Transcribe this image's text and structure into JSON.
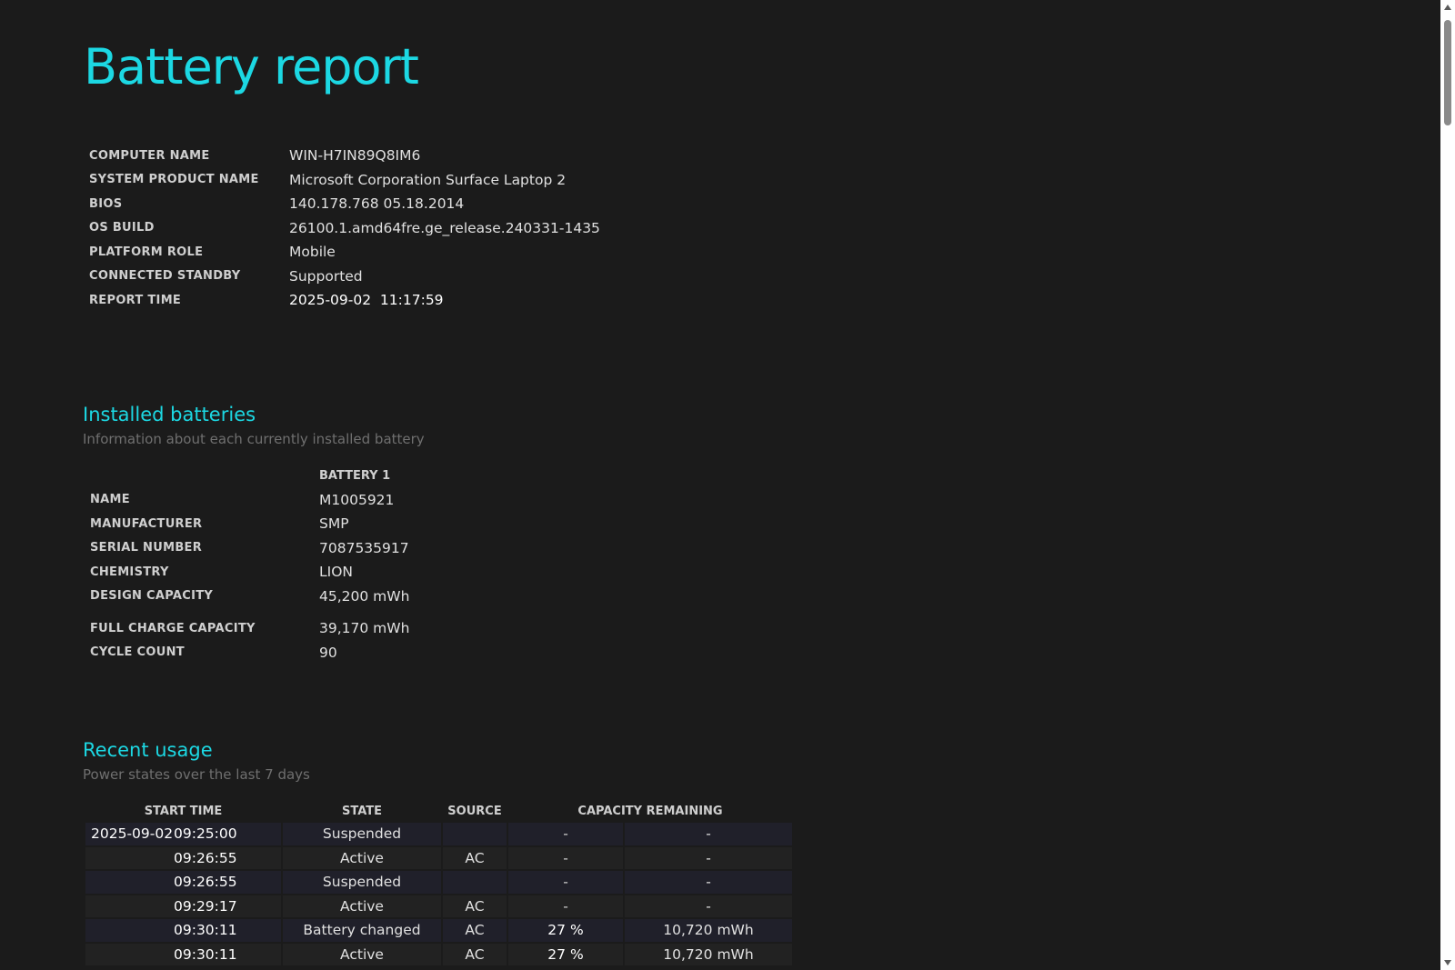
{
  "title": "Battery report",
  "system": [
    {
      "label": "COMPUTER NAME",
      "value": "WIN-H7IN89Q8IM6"
    },
    {
      "label": "SYSTEM PRODUCT NAME",
      "value": "Microsoft Corporation Surface Laptop 2"
    },
    {
      "label": "BIOS",
      "value": "140.178.768 05.18.2014"
    },
    {
      "label": "OS BUILD",
      "value": "26100.1.amd64fre.ge_release.240331-1435"
    },
    {
      "label": "PLATFORM ROLE",
      "value": "Mobile"
    },
    {
      "label": "CONNECTED STANDBY",
      "value": "Supported"
    },
    {
      "label": "REPORT TIME",
      "value": "2025-09-02  11:17:59"
    }
  ],
  "installed_batteries": {
    "heading": "Installed batteries",
    "subtitle": "Information about each currently installed battery",
    "column": "BATTERY 1",
    "rows": [
      {
        "label": "NAME",
        "value": "M1005921"
      },
      {
        "label": "MANUFACTURER",
        "value": "SMP"
      },
      {
        "label": "SERIAL NUMBER",
        "value": "7087535917"
      },
      {
        "label": "CHEMISTRY",
        "value": "LION"
      },
      {
        "label": "DESIGN CAPACITY",
        "value": "45,200 mWh"
      },
      {
        "label": "FULL CHARGE CAPACITY",
        "value": "39,170 mWh"
      },
      {
        "label": "CYCLE COUNT",
        "value": "90"
      }
    ]
  },
  "recent_usage": {
    "heading": "Recent usage",
    "subtitle": "Power states over the last 7 days",
    "columns": [
      "START TIME",
      "STATE",
      "SOURCE",
      "CAPACITY REMAINING"
    ],
    "rows": [
      {
        "date": "2025-09-02",
        "time": "09:25:00",
        "state": "Suspended",
        "source": "",
        "pct": "-",
        "mwh": "-"
      },
      {
        "date": "",
        "time": "09:26:55",
        "state": "Active",
        "source": "AC",
        "pct": "-",
        "mwh": "-"
      },
      {
        "date": "",
        "time": "09:26:55",
        "state": "Suspended",
        "source": "",
        "pct": "-",
        "mwh": "-"
      },
      {
        "date": "",
        "time": "09:29:17",
        "state": "Active",
        "source": "AC",
        "pct": "-",
        "mwh": "-"
      },
      {
        "date": "",
        "time": "09:30:11",
        "state": "Battery changed",
        "source": "AC",
        "pct": "27 %",
        "mwh": "10,720 mWh"
      },
      {
        "date": "",
        "time": "09:30:11",
        "state": "Active",
        "source": "AC",
        "pct": "27 %",
        "mwh": "10,720 mWh"
      }
    ]
  }
}
